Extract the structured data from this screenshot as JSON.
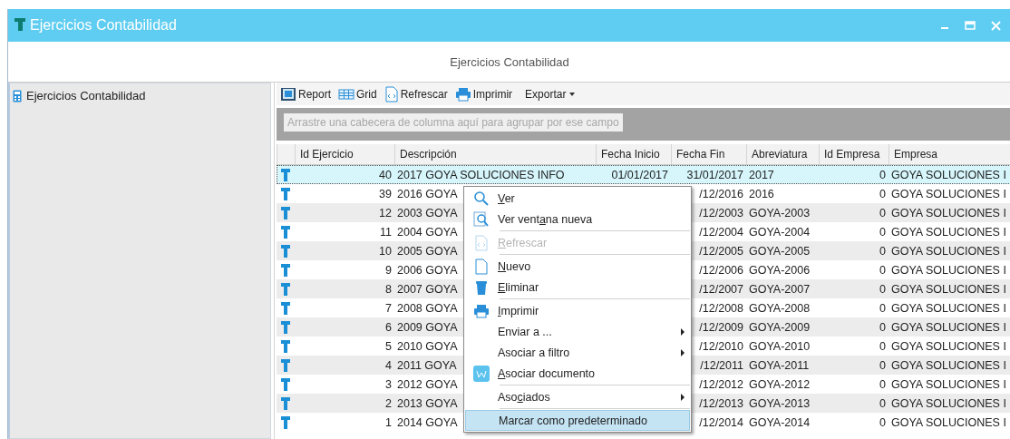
{
  "window": {
    "title": "Ejercicios Contabilidad"
  },
  "page_title": "Ejercicios Contabilidad",
  "sidebar": {
    "items": [
      {
        "label": "Ejercicios Contabilidad"
      }
    ]
  },
  "toolbar": {
    "buttons": [
      {
        "label": "Report"
      },
      {
        "label": "Grid"
      },
      {
        "label": "Refrescar"
      },
      {
        "label": "Imprimir"
      },
      {
        "label": "Exportar"
      }
    ]
  },
  "group_panel": {
    "placeholder": "Arrastre una cabecera de columna aquí para agrupar por ese campo"
  },
  "table": {
    "columns": [
      {
        "label": "Id Ejercicio"
      },
      {
        "label": "Descripción"
      },
      {
        "label": "Fecha Inicio"
      },
      {
        "label": "Fecha Fin"
      },
      {
        "label": "Abreviatura"
      },
      {
        "label": "Id Empresa"
      },
      {
        "label": "Empresa"
      }
    ],
    "rows": [
      {
        "selected": true,
        "cells": [
          "40",
          "2017 GOYA SOLUCIONES INFO",
          "01/01/2017",
          "31/01/2017",
          "2017",
          "0",
          "GOYA SOLUCIONES I"
        ]
      },
      {
        "selected": false,
        "cells": [
          "39",
          "2016 GOYA",
          null,
          "/12/2016",
          "2016",
          "0",
          "GOYA SOLUCIONES I"
        ]
      },
      {
        "selected": false,
        "cells": [
          "12",
          "2003 GOYA",
          null,
          "/12/2003",
          "GOYA-2003",
          "0",
          "GOYA SOLUCIONES I"
        ]
      },
      {
        "selected": false,
        "cells": [
          "11",
          "2004 GOYA",
          null,
          "/12/2004",
          "GOYA-2004",
          "0",
          "GOYA SOLUCIONES I"
        ]
      },
      {
        "selected": false,
        "cells": [
          "10",
          "2005 GOYA",
          null,
          "/12/2005",
          "GOYA-2005",
          "0",
          "GOYA SOLUCIONES I"
        ]
      },
      {
        "selected": false,
        "cells": [
          "9",
          "2006 GOYA",
          null,
          "/12/2006",
          "GOYA-2006",
          "0",
          "GOYA SOLUCIONES I"
        ]
      },
      {
        "selected": false,
        "cells": [
          "8",
          "2007 GOYA",
          null,
          "/12/2007",
          "GOYA-2007",
          "0",
          "GOYA SOLUCIONES I"
        ]
      },
      {
        "selected": false,
        "cells": [
          "7",
          "2008 GOYA",
          null,
          "/12/2008",
          "GOYA-2008",
          "0",
          "GOYA SOLUCIONES I"
        ]
      },
      {
        "selected": false,
        "cells": [
          "6",
          "2009 GOYA",
          null,
          "/12/2009",
          "GOYA-2009",
          "0",
          "GOYA SOLUCIONES I"
        ]
      },
      {
        "selected": false,
        "cells": [
          "5",
          "2010 GOYA",
          null,
          "/12/2010",
          "GOYA-2010",
          "0",
          "GOYA SOLUCIONES I"
        ]
      },
      {
        "selected": false,
        "cells": [
          "4",
          "2011 GOYA",
          null,
          "/12/2011",
          "GOYA-2011",
          "0",
          "GOYA SOLUCIONES I"
        ]
      },
      {
        "selected": false,
        "cells": [
          "3",
          "2012 GOYA",
          null,
          "/12/2012",
          "GOYA-2012",
          "0",
          "GOYA SOLUCIONES I"
        ]
      },
      {
        "selected": false,
        "cells": [
          "2",
          "2013 GOYA",
          null,
          "/12/2013",
          "GOYA-2013",
          "0",
          "GOYA SOLUCIONES I"
        ]
      },
      {
        "selected": false,
        "cells": [
          "1",
          "2014 GOYA",
          null,
          "/12/2014",
          "GOYA-2014",
          "0",
          "GOYA SOLUCIONES I"
        ]
      }
    ]
  },
  "context_menu": {
    "items": [
      {
        "kind": "item",
        "text_parts": [
          {
            "text": "V",
            "underlined": true
          },
          {
            "text": "er",
            "underlined": false
          }
        ],
        "disabled": false,
        "submenu": false,
        "selected": false
      },
      {
        "kind": "item",
        "text_parts": [
          {
            "text": "Ver vent",
            "underlined": false
          },
          {
            "text": "a",
            "underlined": true
          },
          {
            "text": "na nueva",
            "underlined": false
          }
        ],
        "disabled": false,
        "submenu": false,
        "selected": false
      },
      {
        "kind": "separator"
      },
      {
        "kind": "item",
        "text_parts": [
          {
            "text": "R",
            "underlined": true
          },
          {
            "text": "efrescar",
            "underlined": false
          }
        ],
        "disabled": true,
        "submenu": false,
        "selected": false
      },
      {
        "kind": "separator"
      },
      {
        "kind": "item",
        "text_parts": [
          {
            "text": "N",
            "underlined": true
          },
          {
            "text": "uevo",
            "underlined": false
          }
        ],
        "disabled": false,
        "submenu": false,
        "selected": false
      },
      {
        "kind": "item",
        "text_parts": [
          {
            "text": "E",
            "underlined": true
          },
          {
            "text": "liminar",
            "underlined": false
          }
        ],
        "disabled": false,
        "submenu": false,
        "selected": false
      },
      {
        "kind": "separator"
      },
      {
        "kind": "item",
        "text_parts": [
          {
            "text": "I",
            "underlined": true
          },
          {
            "text": "mprimir",
            "underlined": false
          }
        ],
        "disabled": false,
        "submenu": false,
        "selected": false
      },
      {
        "kind": "item",
        "text_parts": [
          {
            "text": "Enviar a ...",
            "underlined": false
          }
        ],
        "disabled": false,
        "submenu": true,
        "selected": false
      },
      {
        "kind": "item",
        "text_parts": [
          {
            "text": "Asociar a filtro",
            "underlined": false
          }
        ],
        "disabled": false,
        "submenu": true,
        "selected": false
      },
      {
        "kind": "item",
        "text_parts": [
          {
            "text": "A",
            "underlined": true
          },
          {
            "text": "sociar documento",
            "underlined": false
          }
        ],
        "disabled": false,
        "submenu": false,
        "selected": false
      },
      {
        "kind": "separator"
      },
      {
        "kind": "item",
        "text_parts": [
          {
            "text": "Aso",
            "underlined": false
          },
          {
            "text": "c",
            "underlined": true
          },
          {
            "text": "iados",
            "underlined": false
          }
        ],
        "disabled": false,
        "submenu": true,
        "selected": false
      },
      {
        "kind": "separator"
      },
      {
        "kind": "item",
        "text_parts": [
          {
            "text": "Marcar como predeterminado",
            "underlined": false
          }
        ],
        "disabled": false,
        "submenu": false,
        "selected": true
      }
    ]
  }
}
